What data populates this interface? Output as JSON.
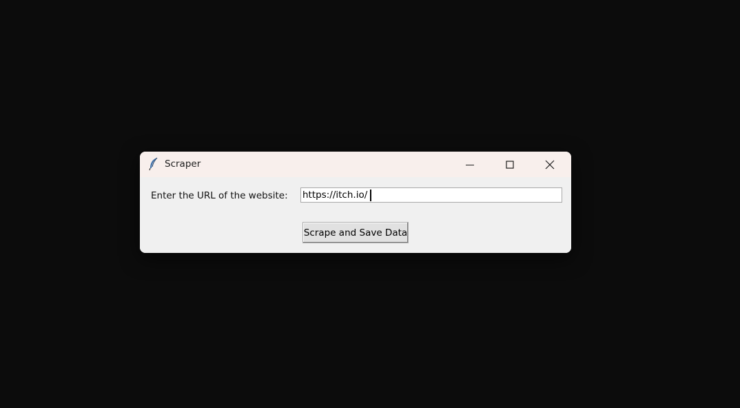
{
  "window": {
    "title": "Scraper",
    "icon": "feather-icon",
    "controls": {
      "minimize": "minimize-icon",
      "maximize": "maximize-icon",
      "close": "close-icon"
    }
  },
  "form": {
    "url_label": "Enter the URL of the website:",
    "url_value": "https://itch.io/",
    "submit_label": "Scrape and Save Data"
  },
  "colors": {
    "desktop_background": "#0c0c0c",
    "titlebar_background": "#f8efec",
    "client_background": "#f0f0f0"
  }
}
